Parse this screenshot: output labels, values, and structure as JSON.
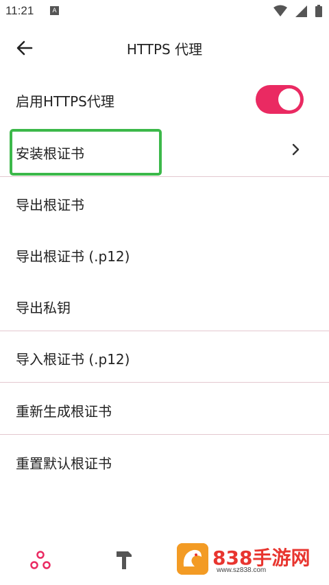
{
  "status_bar": {
    "time": "11:21",
    "notification": "A"
  },
  "header": {
    "title": "HTTPS 代理"
  },
  "settings": {
    "enable_https_proxy": {
      "label": "启用HTTPS代理",
      "enabled": true
    },
    "items": [
      {
        "label": "安装根证书"
      },
      {
        "label": "导出根证书"
      },
      {
        "label": "导出根证书 (.p12)"
      },
      {
        "label": "导出私钥"
      },
      {
        "label": "导入根证书 (.p12)"
      },
      {
        "label": "重新生成根证书"
      },
      {
        "label": "重置默认根证书"
      }
    ]
  },
  "colors": {
    "accent": "#ea2a62",
    "highlight": "#3cb84a",
    "divider": "#e3c7cf"
  },
  "watermark": {
    "brand": "838手游网",
    "url": "www.sz838.com"
  }
}
